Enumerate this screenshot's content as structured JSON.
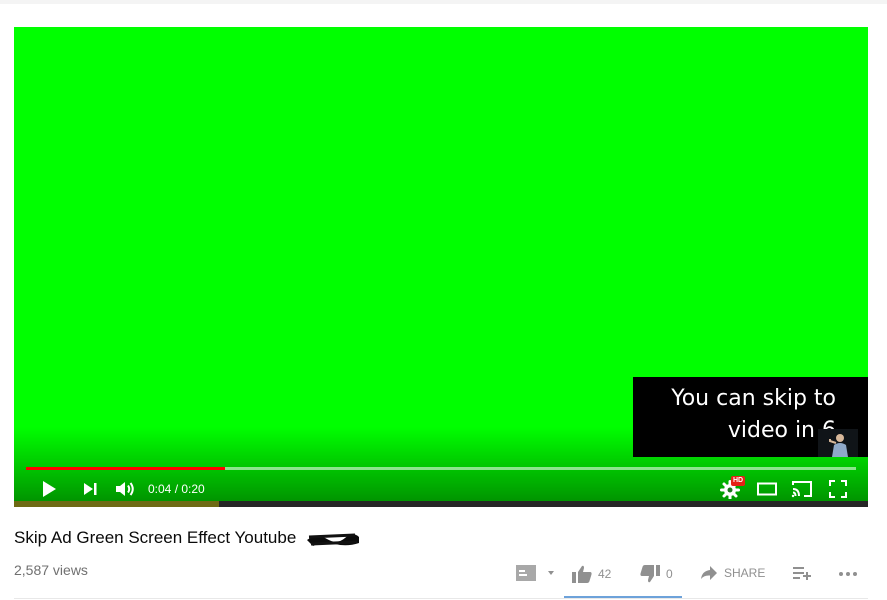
{
  "player": {
    "screen_color": "#00ff00",
    "progress_played_fraction": 0.24,
    "ad_progress_fraction": 0.24,
    "time_display": "0:04 / 0:20",
    "quality_badge": "HD",
    "controls": [
      "play-icon",
      "next-icon",
      "volume-icon",
      "settings-icon",
      "theater-mode-icon",
      "cast-icon",
      "fullscreen-icon"
    ],
    "skip_overlay": {
      "line1": "You can skip to",
      "line2": "video in 6"
    }
  },
  "video": {
    "title": "Skip Ad Green Screen Effect Youtube",
    "views": "2,587 views"
  },
  "actions": {
    "likes": "42",
    "dislikes": "0",
    "share_label": "SHARE"
  },
  "colors": {
    "progress_red": "#ff0000",
    "like_accent": "#6da2da"
  }
}
